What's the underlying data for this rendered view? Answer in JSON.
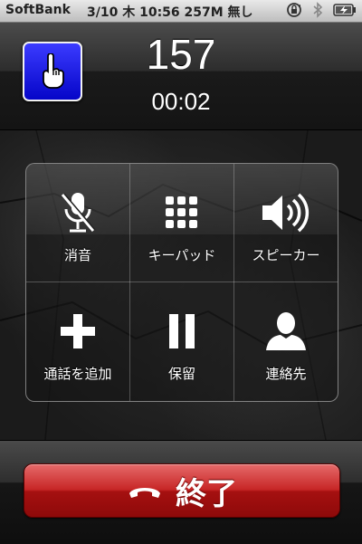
{
  "status_bar": {
    "carrier": "SoftBank",
    "datetime_text": "3/10 木 10:56 257M 無し",
    "icons": [
      "rotation-lock-icon",
      "bluetooth-icon",
      "battery-charging-icon"
    ]
  },
  "call": {
    "caller_icon": "pointing-hand-icon",
    "number": "157",
    "timer": "00:02"
  },
  "keypad": {
    "buttons": [
      {
        "label": "消音",
        "icon": "mute-mic-icon"
      },
      {
        "label": "キーパッド",
        "icon": "keypad-icon"
      },
      {
        "label": "スピーカー",
        "icon": "speaker-icon"
      },
      {
        "label": "通話を追加",
        "icon": "add-call-icon"
      },
      {
        "label": "保留",
        "icon": "hold-icon"
      },
      {
        "label": "連絡先",
        "icon": "contacts-icon"
      }
    ]
  },
  "end_call": {
    "label": "終了",
    "icon": "hang-up-phone-icon",
    "color": "#c72626"
  },
  "colors": {
    "caller_badge": "#0a0ad8",
    "status_bar": "#d4d4d4"
  }
}
